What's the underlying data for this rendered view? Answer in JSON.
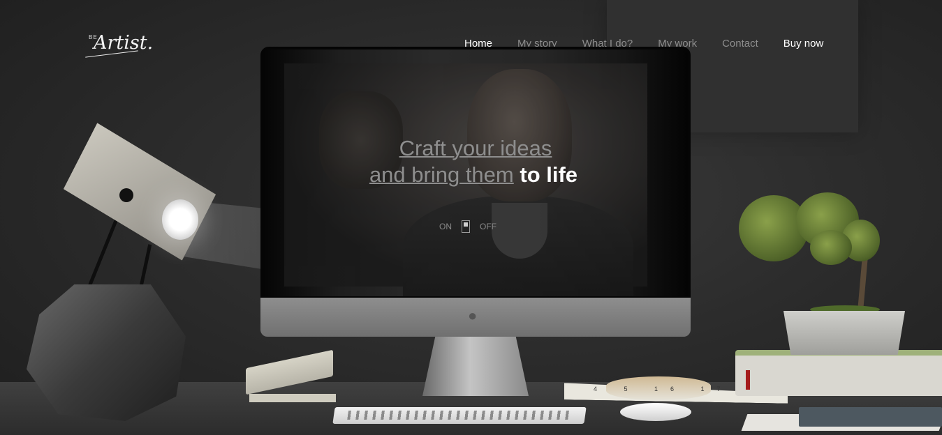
{
  "brand": {
    "prefix": "BE",
    "name": "Artist."
  },
  "nav": {
    "items": [
      {
        "label": "Home",
        "active": true
      },
      {
        "label": "My story",
        "active": false
      },
      {
        "label": "What I do?",
        "active": false
      },
      {
        "label": "My work",
        "active": false
      },
      {
        "label": "Contact",
        "active": false
      },
      {
        "label": "Buy now",
        "active": false
      }
    ]
  },
  "hero": {
    "line1": "Craft your ideas",
    "line2_part1": "and bring them",
    "line2_highlight": "to life"
  },
  "toggle": {
    "on_label": "ON",
    "off_label": "OFF"
  },
  "tape_numbers": "4 5 16 17 18",
  "colors": {
    "background": "#2a2a2a",
    "nav_inactive": "#8d8d8d",
    "nav_active": "#ffffff",
    "headline_muted": "#8e8e8e",
    "headline_highlight": "#ffffff"
  }
}
